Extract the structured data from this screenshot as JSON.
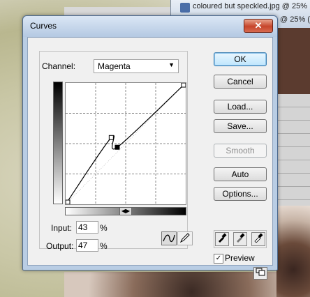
{
  "background": {
    "ruler_text": "",
    "doc_title": "coloured but speckled.jpg @ 25%",
    "doc_zoom": "@ 25% (",
    "panel_rows": [
      "",
      "",
      "",
      "",
      "",
      "",
      "",
      ""
    ]
  },
  "dialog": {
    "title": "Curves",
    "close_label": "✕",
    "channel_label": "Channel:",
    "channel_value": "Magenta",
    "input_label": "Input:",
    "input_value": "43",
    "output_label": "Output:",
    "output_value": "47",
    "percent": "%",
    "buttons": {
      "ok": "OK",
      "cancel": "Cancel",
      "load": "Load...",
      "save": "Save...",
      "smooth": "Smooth",
      "auto": "Auto",
      "options": "Options..."
    },
    "preview_label": "Preview",
    "preview_checked": true,
    "curve_points_pct": [
      [
        0,
        0
      ],
      [
        38,
        55
      ],
      [
        43,
        47
      ],
      [
        100,
        100
      ]
    ]
  }
}
